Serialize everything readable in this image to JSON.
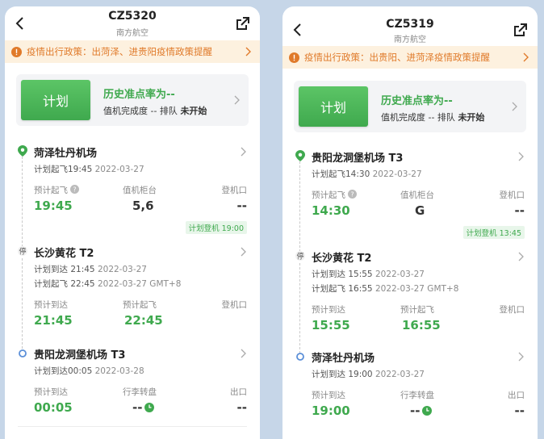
{
  "phones": [
    {
      "flight_no": "CZ5320",
      "airline": "南方航空",
      "notice": "疫情出行政策：出菏泽、进贵阳疫情政策提醒",
      "plan_label": "计划",
      "ontime_rate": "历史准点率为--",
      "checkin_prefix": "值机完成度 -- 排队",
      "checkin_status": "未开始",
      "stops": [
        {
          "airport": "菏泽牡丹机场",
          "line1_label": "计划起飞",
          "line1_time": "19:45",
          "line1_date": "2022-03-27",
          "cols": [
            {
              "label": "预计起飞",
              "value": "19:45"
            },
            {
              "label": "值机柜台",
              "value": "5,6"
            },
            {
              "label": "登机口",
              "value": "--"
            }
          ],
          "badge": "计划登机 19:00"
        },
        {
          "airport": "长沙黄花 T2",
          "stopover_label": "停",
          "line1_label": "计划到达",
          "line1_time": "21:45",
          "line1_date": "2022-03-27",
          "line2_label": "计划起飞",
          "line2_time": "22:45",
          "line2_date": "2022-03-27 GMT+8",
          "cols": [
            {
              "label": "预计到达",
              "value": "21:45"
            },
            {
              "label": "预计起飞",
              "value": "22:45"
            },
            {
              "label": "登机口",
              "value": ""
            }
          ]
        },
        {
          "airport": "贵阳龙洞堡机场 T3",
          "line1_label": "计划到达",
          "line1_time": "00:05",
          "line1_date": "2022-03-28",
          "cols": [
            {
              "label": "预计到达",
              "value": "00:05"
            },
            {
              "label": "行李转盘",
              "value": "--"
            },
            {
              "label": "出口",
              "value": "--"
            }
          ]
        }
      ]
    },
    {
      "flight_no": "CZ5319",
      "airline": "南方航空",
      "notice": "疫情出行政策：出贵阳、进菏泽疫情政策提醒",
      "plan_label": "计划",
      "ontime_rate": "历史准点率为--",
      "checkin_prefix": "值机完成度 -- 排队",
      "checkin_status": "未开始",
      "stops": [
        {
          "airport": "贵阳龙洞堡机场 T3",
          "line1_label": "计划起飞",
          "line1_time": "14:30",
          "line1_date": "2022-03-27",
          "cols": [
            {
              "label": "预计起飞",
              "value": "14:30"
            },
            {
              "label": "值机柜台",
              "value": "G"
            },
            {
              "label": "登机口",
              "value": "--"
            }
          ],
          "badge": "计划登机 13:45"
        },
        {
          "airport": "长沙黄花 T2",
          "stopover_label": "停",
          "line1_label": "计划到达",
          "line1_time": "15:55",
          "line1_date": "2022-03-27",
          "line2_label": "计划起飞",
          "line2_time": "16:55",
          "line2_date": "2022-03-27 GMT+8",
          "cols": [
            {
              "label": "预计到达",
              "value": "15:55"
            },
            {
              "label": "预计起飞",
              "value": "16:55"
            },
            {
              "label": "登机口",
              "value": ""
            }
          ]
        },
        {
          "airport": "菏泽牡丹机场",
          "line1_label": "计划到达",
          "line1_time": "19:00",
          "line1_date": "2022-03-27",
          "cols": [
            {
              "label": "预计到达",
              "value": "19:00"
            },
            {
              "label": "行李转盘",
              "value": "--"
            },
            {
              "label": "出口",
              "value": "--"
            }
          ]
        }
      ]
    }
  ],
  "colors": {
    "green": "#3fa94e",
    "orange": "#e07a2a",
    "notice_bg": "#fdf1df",
    "background": "#c6d6e8"
  },
  "icons": [
    "back-arrow-icon",
    "share-icon",
    "warning-icon",
    "chevron-right-icon",
    "location-pin-icon",
    "stopover-icon",
    "destination-dot-icon",
    "help-icon",
    "clock-icon"
  ]
}
